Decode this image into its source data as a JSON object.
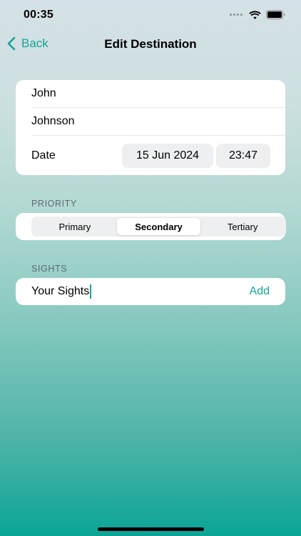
{
  "status_bar": {
    "time": "00:35"
  },
  "nav": {
    "back_label": "Back",
    "title": "Edit Destination"
  },
  "fields": {
    "first_name": "John",
    "last_name": "Johnson",
    "date_label": "Date",
    "date_value": "15 Jun 2024",
    "time_value": "23:47"
  },
  "priority": {
    "section_label": "PRIORITY",
    "options": [
      "Primary",
      "Secondary",
      "Tertiary"
    ],
    "selected": "Secondary"
  },
  "sights": {
    "section_label": "SIGHTS",
    "input_value": "Your Sights",
    "add_label": "Add"
  },
  "colors": {
    "accent": "#13a596",
    "gradient_bottom": "#0aa596"
  },
  "icons": [
    "cellular-signal-icon",
    "wifi-icon",
    "battery-icon",
    "chevron-left-icon"
  ]
}
